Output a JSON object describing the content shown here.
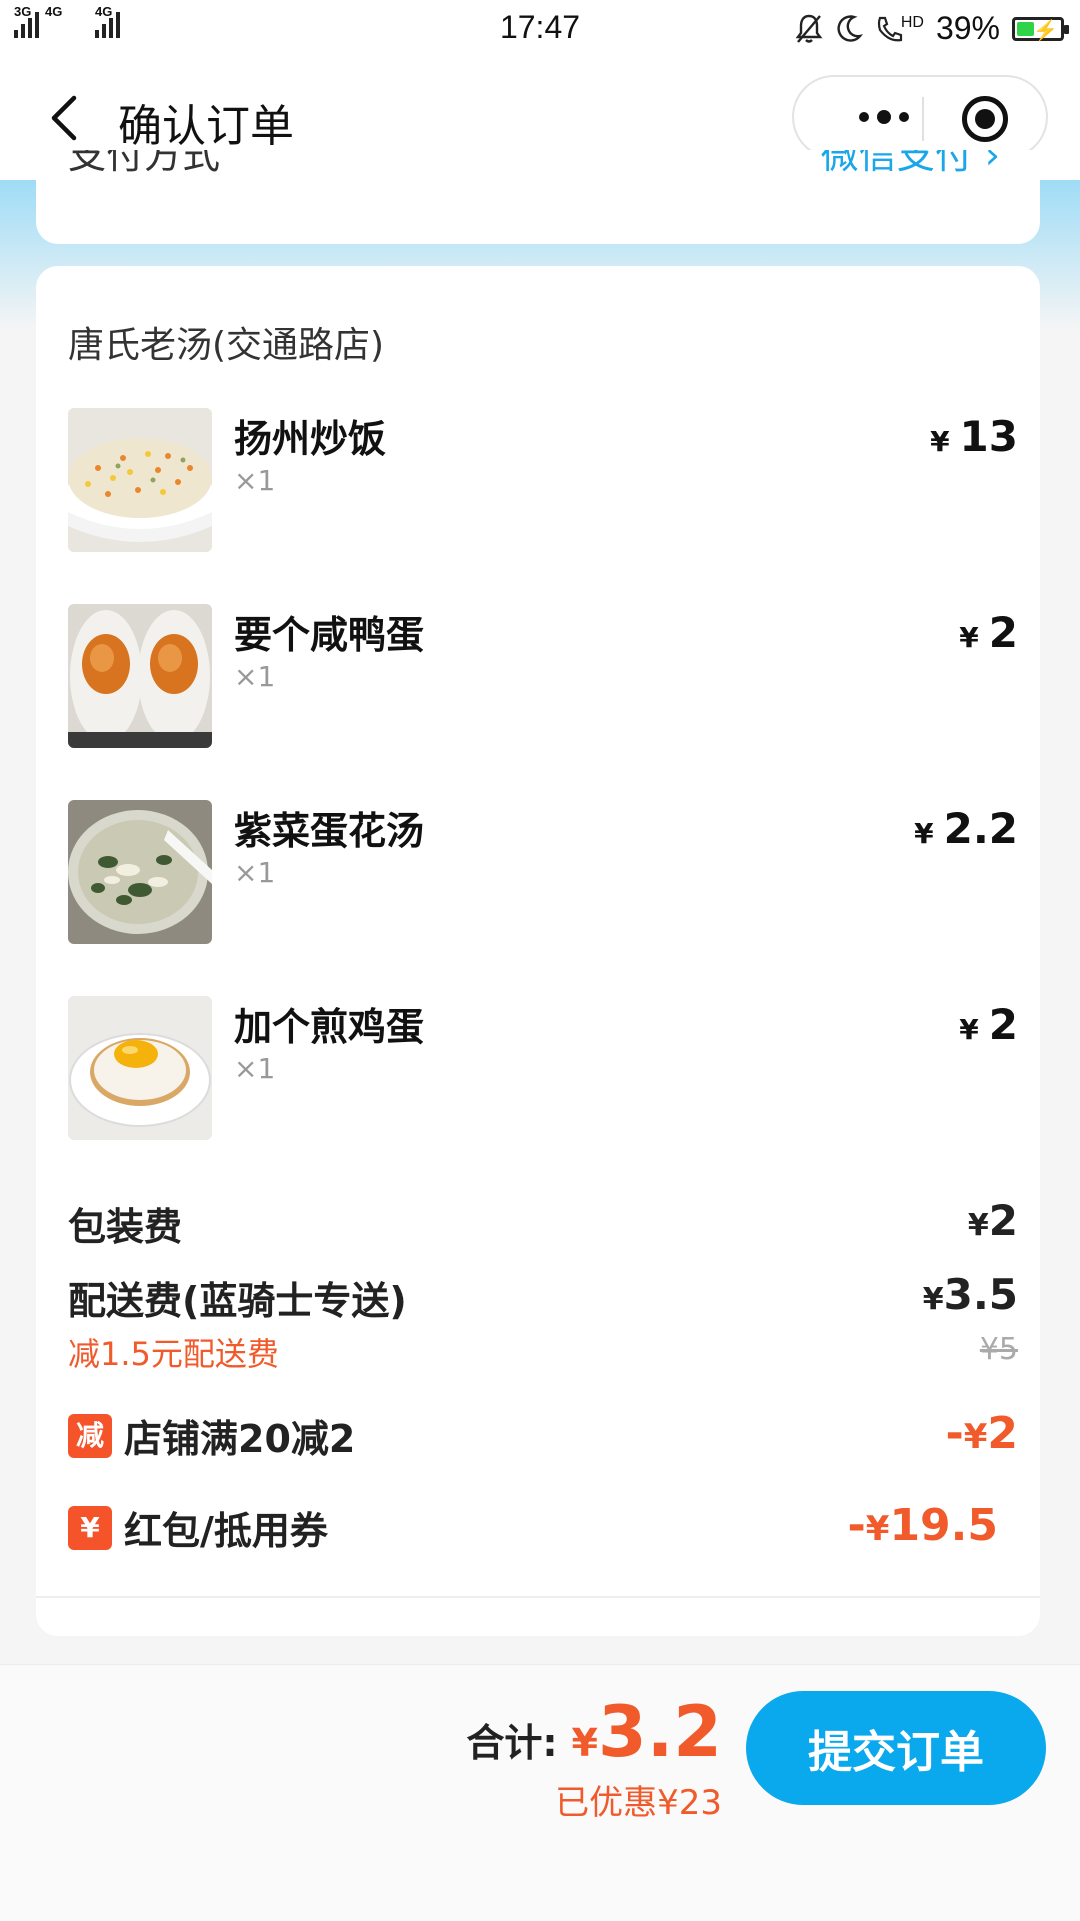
{
  "status_bar": {
    "signal_1_tag": "3G",
    "signal_2_tag": "4G",
    "signal_3_tag": "4G",
    "time": "17:47",
    "hd_tag": "HD",
    "battery_percent": "39%",
    "battery_level": 0.39,
    "battery_color": "#2fd34a"
  },
  "nav": {
    "title": "确认订单",
    "back_icon": "chevron-left-icon",
    "more_icon": "more-dots-icon",
    "close_icon": "target-circle-icon"
  },
  "payment": {
    "label": "支付方式",
    "value": "微信支付 ›"
  },
  "order": {
    "shop_name": "唐氏老汤(交通路店)",
    "items": [
      {
        "name": "扬州炒饭",
        "qty": "×1",
        "yen": "¥",
        "price": "13"
      },
      {
        "name": "要个咸鸭蛋",
        "qty": "×1",
        "yen": "¥",
        "price": "2"
      },
      {
        "name": "紫菜蛋花汤",
        "qty": "×1",
        "yen": "¥",
        "price": "2.2"
      },
      {
        "name": "加个煎鸡蛋",
        "qty": "×1",
        "yen": "¥",
        "price": "2"
      }
    ],
    "packaging": {
      "label": "包装费",
      "yen": "¥",
      "value": "2"
    },
    "delivery": {
      "label": "配送费(蓝骑士专送)",
      "yen": "¥",
      "value": "3.5",
      "discount_note": "减1.5元配送费",
      "original": "¥5"
    },
    "shop_promo": {
      "badge": "减",
      "label": "店铺满20减2",
      "prefix": "-",
      "yen": "¥",
      "value": "2"
    },
    "coupon": {
      "badge": "¥",
      "label": "红包/抵用券",
      "prefix": "-",
      "yen": "¥",
      "value": "19.5"
    }
  },
  "footer": {
    "total_label": "合计:",
    "total_yen": "¥",
    "total_amount": "3.2",
    "saved_text": "已优惠¥23",
    "submit_label": "提交订单"
  },
  "colors": {
    "accent_blue": "#0aa8ec",
    "price_red": "#f15a2b",
    "link_blue": "#1aa6e8"
  }
}
